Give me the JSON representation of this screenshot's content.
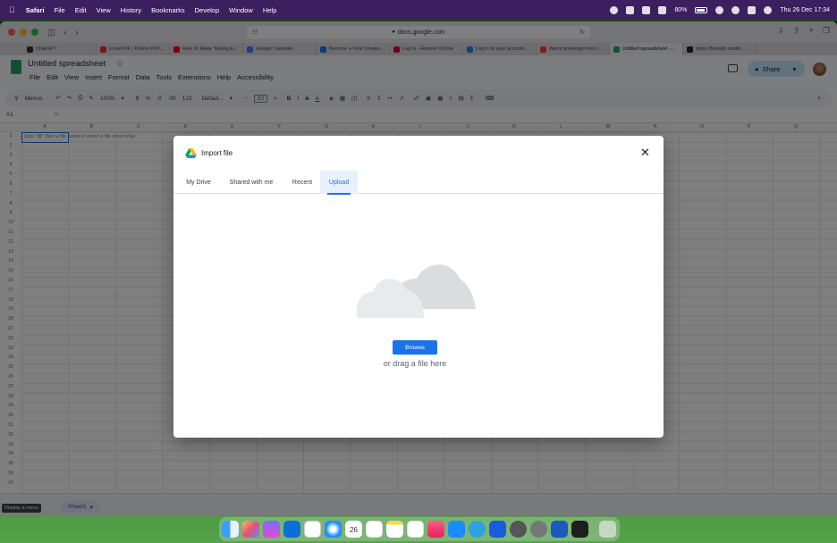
{
  "menubar": {
    "app": "Safari",
    "items": [
      "File",
      "Edit",
      "View",
      "History",
      "Bookmarks",
      "Develop",
      "Window",
      "Help"
    ],
    "battery": "80%",
    "datetime": "Thu 26 Dec 17:34"
  },
  "browser": {
    "url": "docs.google.com",
    "tabs": [
      {
        "label": "ChatGPT",
        "color": "#333333"
      },
      {
        "label": "iLovePDF | Online PDF...",
        "color": "#e5322d"
      },
      {
        "label": "How To Make Talking A...",
        "color": "#ff0000"
      },
      {
        "label": "Google Translate",
        "color": "#4285f4"
      },
      {
        "label": "Become a Viral Creator...",
        "color": "#1a73e8"
      },
      {
        "label": "Log In · Hetzner Online",
        "color": "#d50c2d"
      },
      {
        "label": "Log in to your account...",
        "color": "#1e88e5"
      },
      {
        "label": "Warm greetings from I...",
        "color": "#ea4335"
      },
      {
        "label": "Untitled spreadsheet -...",
        "color": "#1fa463"
      },
      {
        "label": "https://flourish.studio...",
        "color": "#222222"
      }
    ]
  },
  "sheets": {
    "title": "Untitled spreadsheet",
    "menus": [
      "File",
      "Edit",
      "View",
      "Insert",
      "Format",
      "Data",
      "Tools",
      "Extensions",
      "Help",
      "Accessibility"
    ],
    "share_label": "Share",
    "toolbar": {
      "menus": "Menus",
      "zoom": "100%",
      "currency": "$",
      "percent": "%",
      "dec1": ".0",
      "dec2": ".00",
      "num": "123",
      "font": "Defaul...",
      "size": "10"
    },
    "cell_ref": "A1",
    "fx": "fx",
    "columns": [
      "A",
      "B",
      "C",
      "D",
      "E",
      "F",
      "G",
      "H",
      "I",
      "J",
      "K",
      "L",
      "M",
      "N",
      "O",
      "P",
      "Q"
    ],
    "row_count": 37,
    "hint": "Type \"@\" then a file name to insert a file smart chip",
    "tooltip": "Display a menu",
    "sheet_tab": "Sheet1"
  },
  "dialog": {
    "title": "Import file",
    "tabs": [
      "My Drive",
      "Shared with me",
      "Recent",
      "Upload"
    ],
    "active_tab": "Upload",
    "browse_label": "Browse",
    "drag_text": "or drag a file here",
    "accent": "#1a73e8"
  },
  "dock": {
    "icons": [
      "finder-icon",
      "launchpad-icon",
      "stack-icon",
      "vscode-icon",
      "chatgpt-icon",
      "safari-icon",
      "calendar-icon",
      "reminders-icon",
      "notes-icon",
      "freeform-icon",
      "music-icon",
      "appstore-icon",
      "telegram-icon",
      "bitwarden-icon",
      "zoom-icon",
      "system-settings-icon",
      "word-icon",
      "terminal-icon",
      "trash-icon"
    ],
    "calendar_day": "26"
  }
}
